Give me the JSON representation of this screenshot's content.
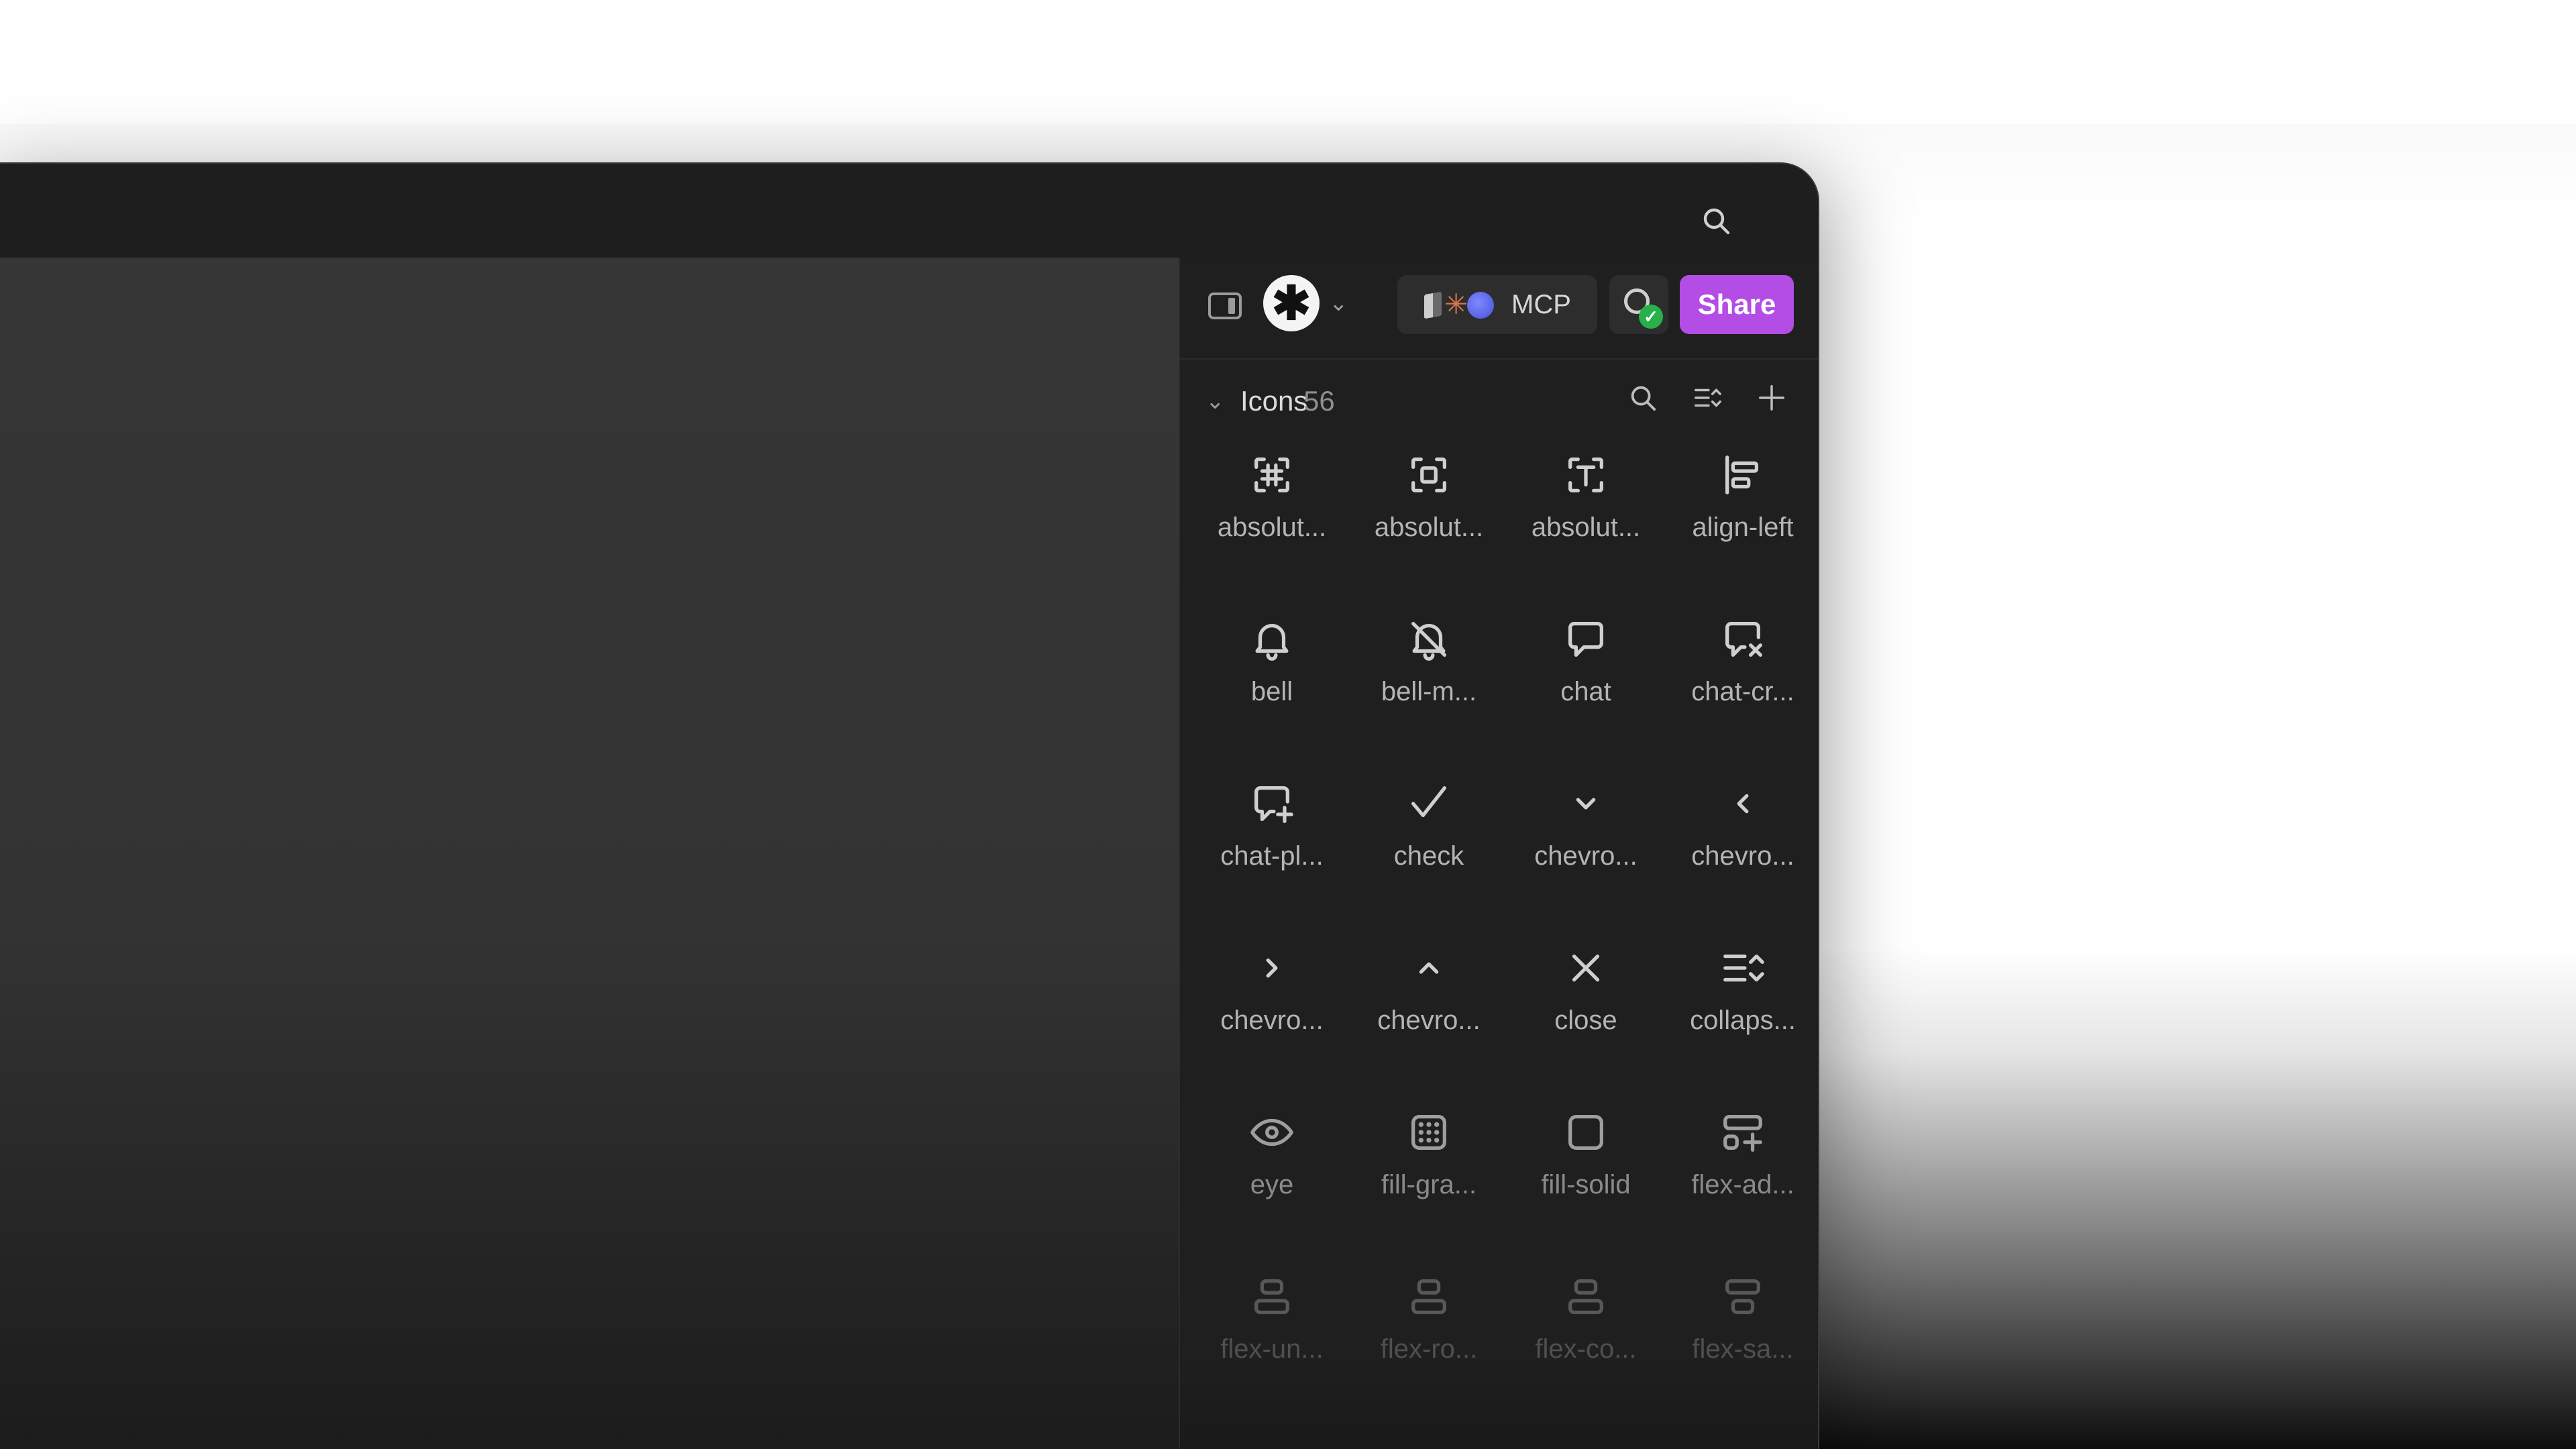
{
  "toolbar": {
    "mcp_label": "MCP",
    "share_label": "Share",
    "share_color": "#b34de6",
    "status_color": "#27b14b"
  },
  "section": {
    "title": "Icons",
    "count": "56"
  },
  "icons": [
    {
      "label": "absolut...",
      "icon": "frame-hash-icon"
    },
    {
      "label": "absolut...",
      "icon": "frame-square-icon"
    },
    {
      "label": "absolut...",
      "icon": "frame-text-icon"
    },
    {
      "label": "align-left",
      "icon": "align-left-icon"
    },
    {
      "label": "bell",
      "icon": "bell-icon"
    },
    {
      "label": "bell-m...",
      "icon": "bell-muted-icon"
    },
    {
      "label": "chat",
      "icon": "chat-icon"
    },
    {
      "label": "chat-cr...",
      "icon": "chat-cross-icon"
    },
    {
      "label": "chat-pl...",
      "icon": "chat-plus-icon"
    },
    {
      "label": "check",
      "icon": "check-icon"
    },
    {
      "label": "chevro...",
      "icon": "chevron-down-icon"
    },
    {
      "label": "chevro...",
      "icon": "chevron-left-icon"
    },
    {
      "label": "chevro...",
      "icon": "chevron-right-icon"
    },
    {
      "label": "chevro...",
      "icon": "chevron-up-icon"
    },
    {
      "label": "close",
      "icon": "close-icon"
    },
    {
      "label": "collaps...",
      "icon": "collapse-icon"
    },
    {
      "label": "eye",
      "icon": "eye-icon"
    },
    {
      "label": "fill-gra...",
      "icon": "fill-gradient-icon"
    },
    {
      "label": "fill-solid",
      "icon": "fill-solid-icon"
    },
    {
      "label": "flex-ad...",
      "icon": "flex-add-icon"
    },
    {
      "label": "flex-un...",
      "icon": "flex-align-icon"
    },
    {
      "label": "flex-ro...",
      "icon": "flex-align-icon"
    },
    {
      "label": "flex-co...",
      "icon": "flex-align-icon"
    },
    {
      "label": "flex-sa...",
      "icon": "flex-center-icon"
    }
  ]
}
